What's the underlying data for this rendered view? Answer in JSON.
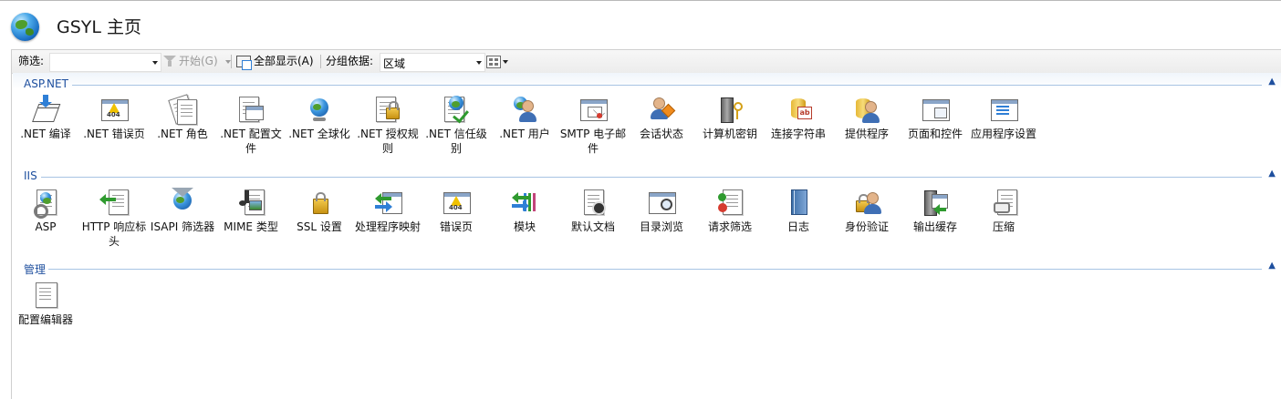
{
  "page": {
    "title": "GSYL 主页"
  },
  "toolbar": {
    "filter_label": "筛选:",
    "filter_value": "",
    "start_label": "开始(G)",
    "show_all_label": "全部显示(A)",
    "groupby_label": "分组依据:",
    "groupby_value": "区域"
  },
  "groups": [
    {
      "name": "ASP.NET",
      "items": [
        {
          "label": ".NET 编译",
          "icon": "net-compilation-icon"
        },
        {
          "label": ".NET 错误页",
          "icon": "net-error-pages-icon"
        },
        {
          "label": ".NET 角色",
          "icon": "net-roles-icon"
        },
        {
          "label": ".NET 配置文件",
          "icon": "net-profile-icon"
        },
        {
          "label": ".NET 全球化",
          "icon": "net-globalization-icon"
        },
        {
          "label": ".NET 授权规则",
          "icon": "net-authorization-rules-icon"
        },
        {
          "label": ".NET 信任级别",
          "icon": "net-trust-levels-icon"
        },
        {
          "label": ".NET 用户",
          "icon": "net-users-icon"
        },
        {
          "label": "SMTP 电子邮件",
          "icon": "smtp-email-icon"
        },
        {
          "label": "会话状态",
          "icon": "session-state-icon"
        },
        {
          "label": "计算机密钥",
          "icon": "machine-key-icon"
        },
        {
          "label": "连接字符串",
          "icon": "connection-strings-icon"
        },
        {
          "label": "提供程序",
          "icon": "providers-icon"
        },
        {
          "label": "页面和控件",
          "icon": "pages-and-controls-icon"
        },
        {
          "label": "应用程序设置",
          "icon": "application-settings-icon"
        }
      ]
    },
    {
      "name": "IIS",
      "items": [
        {
          "label": "ASP",
          "icon": "asp-icon"
        },
        {
          "label": "HTTP 响应标头",
          "icon": "http-response-headers-icon"
        },
        {
          "label": "ISAPI 筛选器",
          "icon": "isapi-filters-icon"
        },
        {
          "label": "MIME 类型",
          "icon": "mime-types-icon"
        },
        {
          "label": "SSL 设置",
          "icon": "ssl-settings-icon"
        },
        {
          "label": "处理程序映射",
          "icon": "handler-mappings-icon"
        },
        {
          "label": "错误页",
          "icon": "error-pages-icon"
        },
        {
          "label": "模块",
          "icon": "modules-icon"
        },
        {
          "label": "默认文档",
          "icon": "default-document-icon"
        },
        {
          "label": "目录浏览",
          "icon": "directory-browsing-icon"
        },
        {
          "label": "请求筛选",
          "icon": "request-filtering-icon"
        },
        {
          "label": "日志",
          "icon": "logging-icon"
        },
        {
          "label": "身份验证",
          "icon": "authentication-icon"
        },
        {
          "label": "输出缓存",
          "icon": "output-caching-icon"
        },
        {
          "label": "压缩",
          "icon": "compression-icon"
        }
      ]
    },
    {
      "name": "管理",
      "items": [
        {
          "label": "配置编辑器",
          "icon": "configuration-editor-icon"
        }
      ]
    }
  ]
}
